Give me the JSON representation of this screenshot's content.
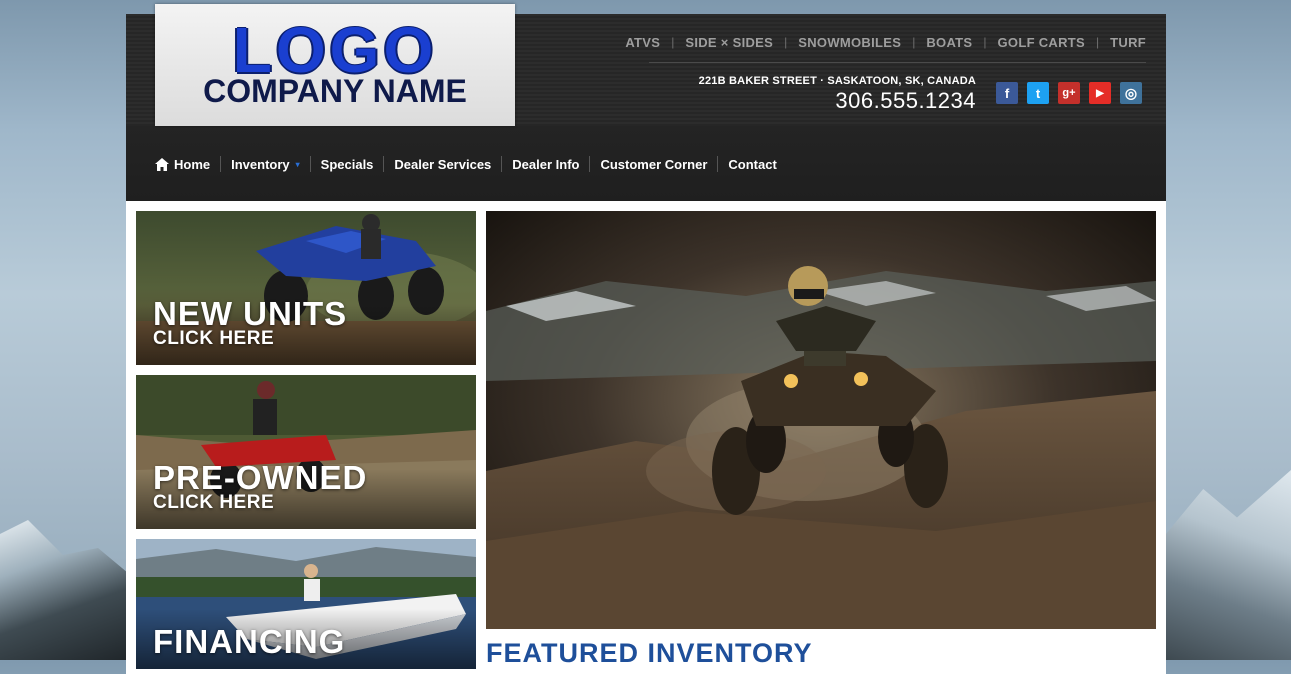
{
  "logo": {
    "word": "LOGO",
    "company": "COMPANY NAME"
  },
  "topnav": [
    "ATVS",
    "SIDE × SIDES",
    "SNOWMOBILES",
    "BOATS",
    "GOLF CARTS",
    "TURF"
  ],
  "contact": {
    "address": "221B BAKER STREET · SASKATOON, SK, CANADA",
    "phone": "306.555.1234"
  },
  "social": [
    {
      "icon": "facebook-icon",
      "glyph": "f",
      "color": "#3b5998"
    },
    {
      "icon": "twitter-icon",
      "glyph": "t",
      "color": "#1da1f2"
    },
    {
      "icon": "google-plus-icon",
      "glyph": "g+",
      "color": "#c4302b"
    },
    {
      "icon": "youtube-icon",
      "glyph": "▶",
      "color": "#e52d27"
    },
    {
      "icon": "instagram-icon",
      "glyph": "◎",
      "color": "#3f729b"
    }
  ],
  "mainnav": [
    "Home",
    "Inventory",
    "Specials",
    "Dealer Services",
    "Dealer Info",
    "Customer Corner",
    "Contact"
  ],
  "tiles": [
    {
      "title": "NEW UNITS",
      "cta": "CLICK HERE"
    },
    {
      "title": "PRE-OWNED",
      "cta": "CLICK HERE"
    },
    {
      "title": "FINANCING",
      "cta": ""
    }
  ],
  "featured": "FEATURED INVENTORY"
}
